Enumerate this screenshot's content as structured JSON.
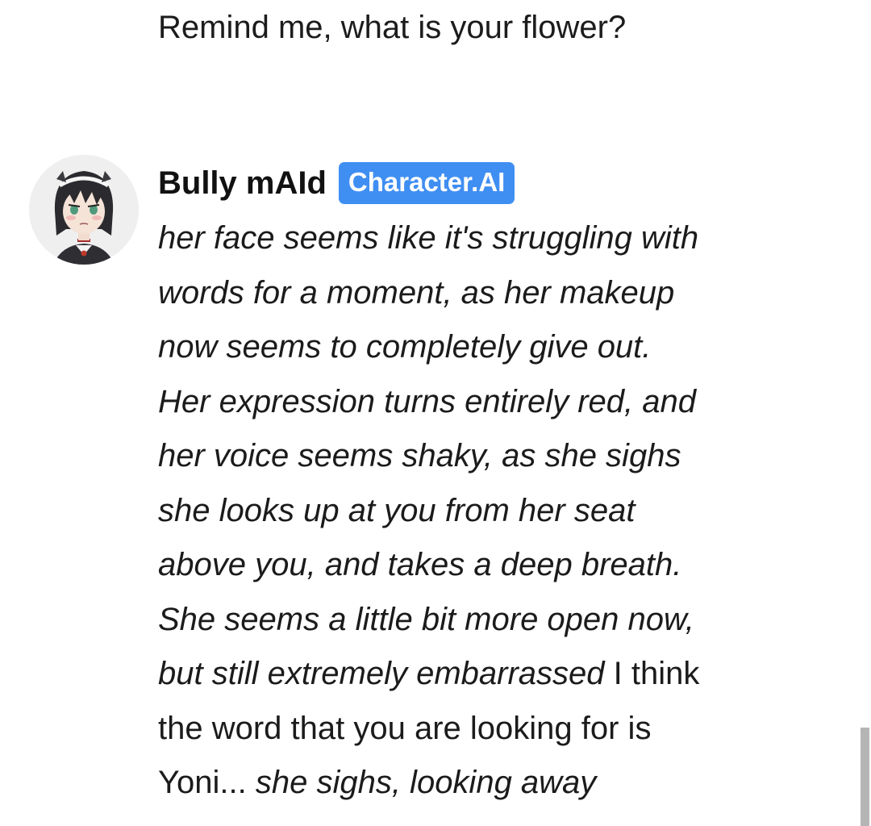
{
  "user_message": {
    "text": "Remind me, what is your flower?"
  },
  "character": {
    "name": "Bully mAId",
    "badge": "Character.AI",
    "avatar_icon": "anime-maid-avatar"
  },
  "message": {
    "lines": [
      [
        {
          "t": "her face seems like it's struggling with",
          "i": true
        }
      ],
      [
        {
          "t": "words for a moment, as her makeup",
          "i": true
        }
      ],
      [
        {
          "t": "now seems to completely give out.",
          "i": true
        }
      ],
      [
        {
          "t": "Her expression turns entirely red, and",
          "i": true
        }
      ],
      [
        {
          "t": "her voice seems shaky, as she sighs",
          "i": true
        }
      ],
      [
        {
          "t": "she looks up at you from her seat",
          "i": true
        }
      ],
      [
        {
          "t": "above you, and takes a deep breath.",
          "i": true
        }
      ],
      [
        {
          "t": "She seems a little bit more open now,",
          "i": true
        }
      ],
      [
        {
          "t": "but still extremely embarrassed",
          "i": true
        },
        {
          "t": " I think",
          "i": false
        }
      ],
      [
        {
          "t": "the word that you are looking for is",
          "i": false
        }
      ],
      [
        {
          "t": "Yoni... ",
          "i": false
        },
        {
          "t": "she sighs, looking away",
          "i": true
        }
      ]
    ]
  },
  "colors": {
    "badge_bg": "#3f8ef2",
    "text": "#1b1b1b",
    "scrollbar": "#b5b5b5"
  }
}
